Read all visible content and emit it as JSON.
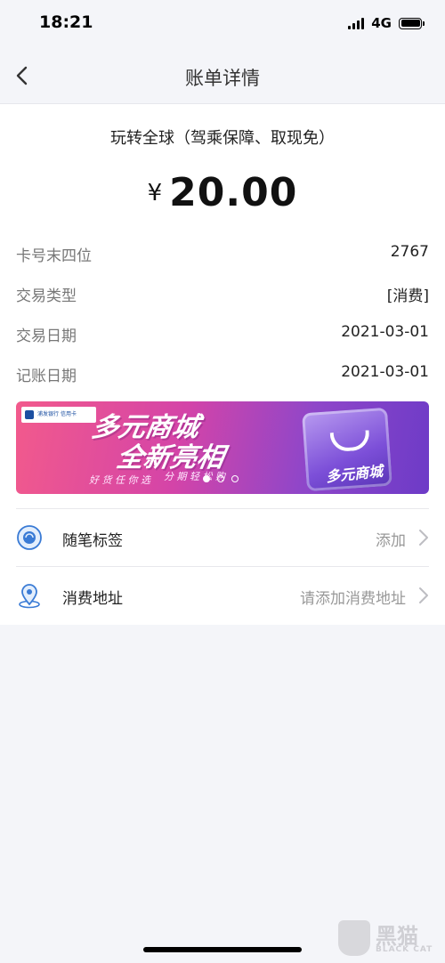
{
  "status_bar": {
    "time": "18:21",
    "network": "4G"
  },
  "nav": {
    "title": "账单详情"
  },
  "transaction": {
    "merchant": "玩转全球（驾乘保障、取现免）",
    "currency_symbol": "¥",
    "amount": "20.00"
  },
  "details": [
    {
      "label": "卡号末四位",
      "value": "2767"
    },
    {
      "label": "交易类型",
      "value": "[消费]"
    },
    {
      "label": "交易日期",
      "value": "2021-03-01"
    },
    {
      "label": "记账日期",
      "value": "2021-03-01"
    }
  ],
  "banner": {
    "logo_line1": "浦发银行",
    "logo_line2": "信用卡",
    "headline1": "多元商城",
    "headline2": "全新亮相",
    "sub1": "好 货 任 你 选",
    "sub2": "分 期 轻 松 购",
    "box_text": "多元商城",
    "slide_count": 3,
    "active_slide": 1
  },
  "rows": [
    {
      "label": "随笔标签",
      "value": "添加",
      "icon": "tag-icon"
    },
    {
      "label": "消费地址",
      "value": "请添加消费地址",
      "icon": "location-pin-icon"
    }
  ],
  "watermark": {
    "main": "黑猫",
    "sub": "BLACK CAT"
  },
  "colors": {
    "accent_blue": "#3a7bd5",
    "background": "#f4f5f9",
    "card": "#ffffff"
  }
}
